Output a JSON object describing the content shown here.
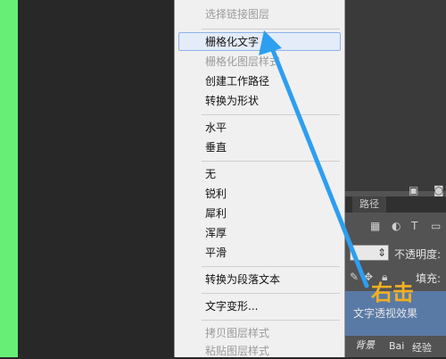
{
  "menu": {
    "items": [
      {
        "label": "选择链接图层",
        "disabled": true
      },
      {
        "label": "栅格化文字",
        "disabled": false,
        "highlighted": true
      },
      {
        "label": "栅格化图层样式",
        "disabled": true
      },
      {
        "label": "创建工作路径",
        "disabled": false
      },
      {
        "label": "转换为形状",
        "disabled": false
      },
      {
        "label": "水平",
        "disabled": false
      },
      {
        "label": "垂直",
        "disabled": false
      },
      {
        "label": "无",
        "disabled": false
      },
      {
        "label": "锐利",
        "disabled": false
      },
      {
        "label": "犀利",
        "disabled": false
      },
      {
        "label": "浑厚",
        "disabled": false
      },
      {
        "label": "平滑",
        "disabled": false
      },
      {
        "label": "转换为段落文本",
        "disabled": false
      },
      {
        "label": "文字变形...",
        "disabled": false
      },
      {
        "label": "拷贝图层样式",
        "disabled": true
      },
      {
        "label": "粘贴图层样式",
        "disabled": true
      }
    ]
  },
  "layers_panel": {
    "tab_label": "路径",
    "opacity_label": "不透明度:",
    "fill_label": "填充:",
    "layer_name": "文字透视效果",
    "background_layer": "背景"
  },
  "annotation": {
    "text": "右击",
    "color": "#f2b020"
  },
  "watermark": {
    "text": "经验",
    "brand": "Bai"
  }
}
